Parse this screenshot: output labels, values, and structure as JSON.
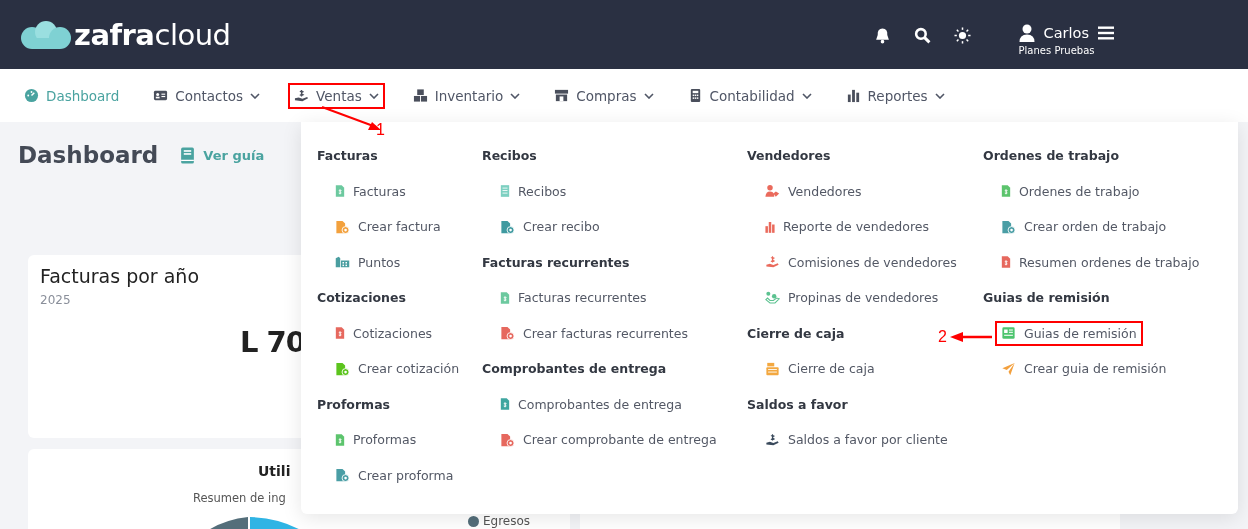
{
  "header": {
    "logo": "**zafra**cloud",
    "user": {
      "name": "Carlos",
      "plan": "Planes Pruebas"
    }
  },
  "nav": [
    {
      "label": "Dashboard",
      "kind": "gauge",
      "selected": true,
      "dropdown": false,
      "highlighted": false
    },
    {
      "label": "Contactos",
      "kind": "contact",
      "selected": false,
      "dropdown": true,
      "highlighted": false
    },
    {
      "label": "Ventas",
      "kind": "hand",
      "selected": false,
      "dropdown": true,
      "highlighted": true
    },
    {
      "label": "Inventario",
      "kind": "boxes",
      "selected": false,
      "dropdown": true,
      "highlighted": false
    },
    {
      "label": "Compras",
      "kind": "store",
      "selected": false,
      "dropdown": true,
      "highlighted": false
    },
    {
      "label": "Contabilidad",
      "kind": "calculator",
      "selected": false,
      "dropdown": true,
      "highlighted": false
    },
    {
      "label": "Reportes",
      "kind": "chart",
      "selected": false,
      "dropdown": true,
      "highlighted": false
    }
  ],
  "page": {
    "title": "Dashboard",
    "guide_link": "Ver guía",
    "card_invoices": {
      "title": "Facturas por año",
      "year": "2025",
      "amount": "L 70"
    },
    "card_profit": {
      "title": "Utili",
      "subtitle": "Resumen de ing",
      "legend": "Egresos"
    }
  },
  "menu": {
    "columns": [
      {
        "groups": [
          {
            "heading": "Facturas",
            "items": [
              {
                "label": "Facturas",
                "kind": "doc",
                "color": "#6cc99f",
                "highlighted": false
              },
              {
                "label": "Crear factura",
                "kind": "doc-add",
                "color": "#f3a13d",
                "highlighted": false
              },
              {
                "label": "Puntos",
                "kind": "buildings",
                "color": "#4a9ea0",
                "highlighted": false
              }
            ]
          },
          {
            "heading": "Cotizaciones",
            "items": [
              {
                "label": "Cotizaciones",
                "kind": "doc",
                "color": "#e6685e",
                "highlighted": false
              },
              {
                "label": "Crear cotización",
                "kind": "doc-add",
                "color": "#5cc41d",
                "highlighted": false
              }
            ]
          },
          {
            "heading": "Proformas",
            "items": [
              {
                "label": "Proformas",
                "kind": "doc",
                "color": "#5cc46d",
                "highlighted": false
              },
              {
                "label": "Crear proforma",
                "kind": "doc-add",
                "color": "#4a9ea5",
                "highlighted": false
              }
            ]
          }
        ]
      },
      {
        "groups": [
          {
            "heading": "Recibos",
            "items": [
              {
                "label": "Recibos",
                "kind": "receipt",
                "color": "#7dd0c1",
                "highlighted": false
              },
              {
                "label": "Crear recibo",
                "kind": "doc-add",
                "color": "#3f9aa0",
                "highlighted": false
              }
            ]
          },
          {
            "heading": "Facturas recurrentes",
            "items": [
              {
                "label": "Facturas recurrentes",
                "kind": "doc",
                "color": "#6cc99f",
                "highlighted": false
              },
              {
                "label": "Crear facturas recurrentes",
                "kind": "doc-add",
                "color": "#e6685e",
                "highlighted": false
              }
            ]
          },
          {
            "heading": "Comprobantes de entrega",
            "items": [
              {
                "label": "Comprobantes de entrega",
                "kind": "doc",
                "color": "#3fa6a0",
                "highlighted": false
              },
              {
                "label": "Crear comprobante de entrega",
                "kind": "doc-add",
                "color": "#e6685e",
                "highlighted": false
              }
            ]
          }
        ]
      },
      {
        "groups": [
          {
            "heading": "Vendedores",
            "items": [
              {
                "label": "Vendedores",
                "kind": "user-tag",
                "color": "#ea6a5c",
                "highlighted": false
              },
              {
                "label": "Reporte de vendedores",
                "kind": "bars",
                "color": "#ea6a5c",
                "highlighted": false
              },
              {
                "label": "Comisiones de vendedores",
                "kind": "hand",
                "color": "#ea6a5c",
                "highlighted": false
              },
              {
                "label": "Propinas de vendedores",
                "kind": "tips",
                "color": "#5cc290",
                "highlighted": false
              }
            ]
          },
          {
            "heading": "Cierre de caja",
            "items": [
              {
                "label": "Cierre de caja",
                "kind": "register",
                "color": "#f3a840",
                "highlighted": false
              }
            ]
          },
          {
            "heading": "Saldos a favor",
            "items": [
              {
                "label": "Saldos a favor por cliente",
                "kind": "hand",
                "color": "#3a4a5c",
                "highlighted": false
              }
            ]
          }
        ]
      },
      {
        "groups": [
          {
            "heading": "Ordenes de trabajo",
            "items": [
              {
                "label": "Ordenes de trabajo",
                "kind": "doc",
                "color": "#5cc46d",
                "highlighted": false
              },
              {
                "label": "Crear orden de trabajo",
                "kind": "doc-add",
                "color": "#4a9ea5",
                "highlighted": false
              },
              {
                "label": "Resumen ordenes de trabajo",
                "kind": "doc",
                "color": "#e6685e",
                "highlighted": false
              }
            ]
          },
          {
            "heading": "Guias de remisión",
            "items": [
              {
                "label": "Guias de remisión",
                "kind": "newspaper",
                "color": "#4cc46d",
                "highlighted": true
              },
              {
                "label": "Crear guia de remisión",
                "kind": "send",
                "color": "#f3a03d",
                "highlighted": false
              }
            ]
          }
        ]
      }
    ]
  },
  "annotations": [
    {
      "label": "1"
    },
    {
      "label": "2"
    }
  ]
}
